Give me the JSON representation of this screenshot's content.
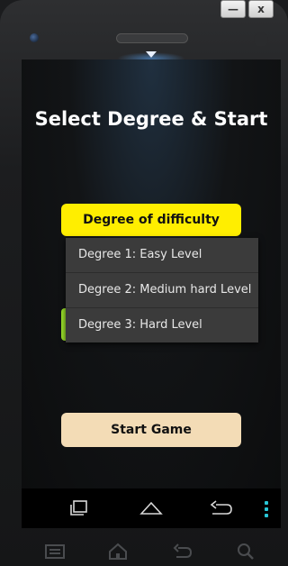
{
  "window": {
    "minimize_label": "—",
    "close_label": "x"
  },
  "app": {
    "title": "Select Degree & Start",
    "difficulty_label": "Degree of difficulty",
    "menu_items": [
      "Degree 1: Easy Level",
      "Degree 2: Medium hard Level",
      "Degree 3: Hard Level"
    ],
    "start_label": "Start Game"
  },
  "colors": {
    "difficulty_button": "#ffee00",
    "start_button": "#f3dcb6",
    "accent_green": "#9adf2a",
    "nav_dots": "#29c6d6"
  },
  "icons": {
    "nav": [
      "recent-apps-icon",
      "home-icon",
      "back-icon",
      "menu-dots-icon"
    ],
    "hardware": [
      "menu-icon",
      "home-icon",
      "back-icon",
      "search-icon"
    ]
  }
}
